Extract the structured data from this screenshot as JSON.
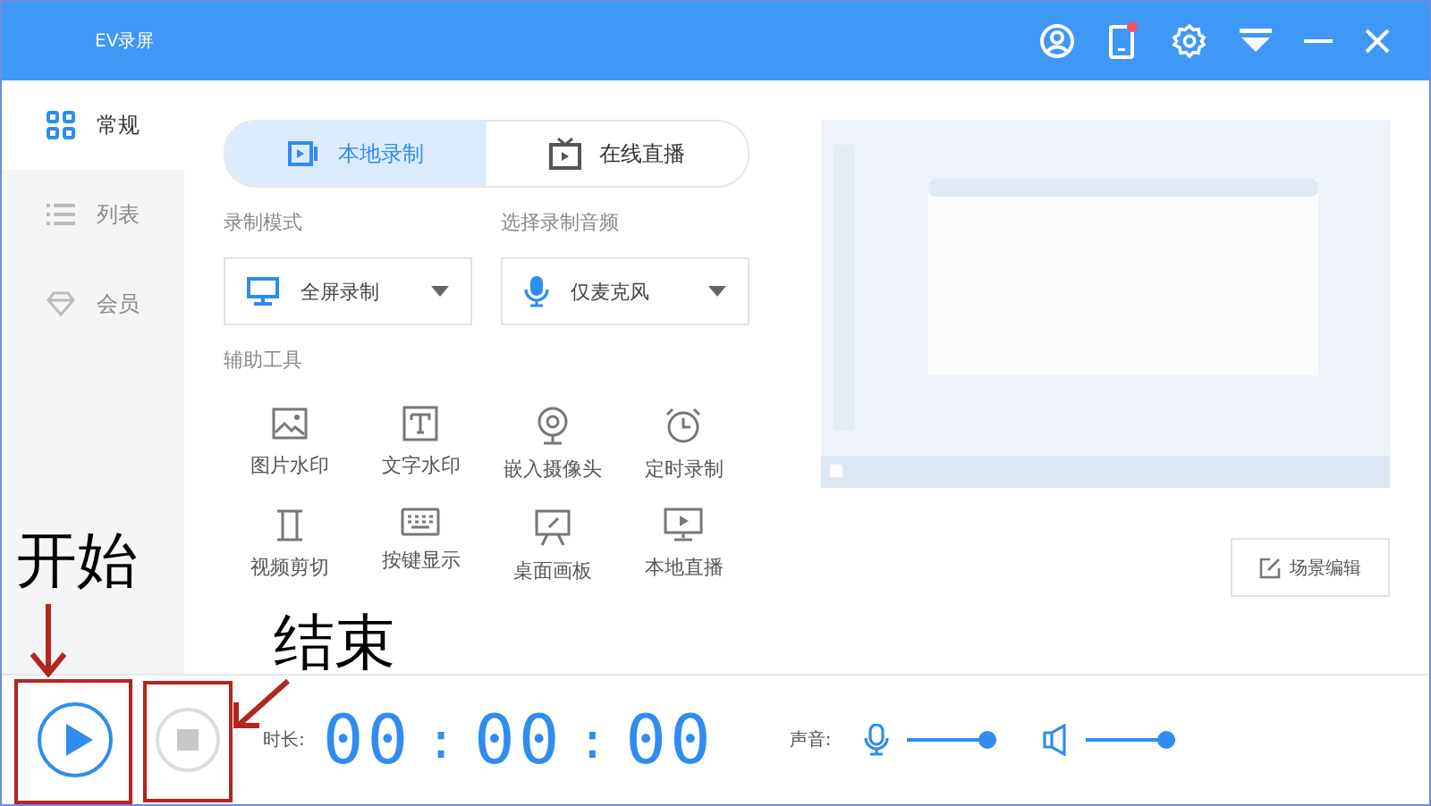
{
  "window": {
    "title": "EV录屏"
  },
  "sidebar": {
    "items": [
      {
        "label": "常规",
        "selected": true,
        "kind": "grid"
      },
      {
        "label": "列表",
        "selected": false,
        "kind": "list"
      },
      {
        "label": "会员",
        "selected": false,
        "kind": "gem"
      }
    ]
  },
  "tabs": [
    {
      "label": "本地录制",
      "selected": true,
      "kind": "record"
    },
    {
      "label": "在线直播",
      "selected": false,
      "kind": "tv"
    }
  ],
  "record_mode": {
    "label": "录制模式",
    "value": "全屏录制"
  },
  "audio": {
    "label": "选择录制音频",
    "value": "仅麦克风"
  },
  "tools": {
    "label": "辅助工具",
    "items": [
      {
        "label": "图片水印",
        "kind": "image"
      },
      {
        "label": "文字水印",
        "kind": "text"
      },
      {
        "label": "嵌入摄像头",
        "kind": "camera"
      },
      {
        "label": "定时录制",
        "kind": "clock"
      },
      {
        "label": "视频剪切",
        "kind": "cut"
      },
      {
        "label": "按键显示",
        "kind": "keyboard"
      },
      {
        "label": "桌面画板",
        "kind": "board"
      },
      {
        "label": "本地直播",
        "kind": "live"
      }
    ]
  },
  "scene_button": "场景编辑",
  "bottom": {
    "duration_label": "时长:",
    "time": [
      "00",
      ":",
      "00",
      ":",
      "00"
    ],
    "sound_label": "声音:",
    "sliders": [
      {
        "kind": "mic",
        "level": 1
      },
      {
        "kind": "speaker",
        "level": 1
      }
    ]
  },
  "annotations": [
    {
      "text": "开始",
      "kind": "start"
    },
    {
      "text": "结束",
      "kind": "stop"
    }
  ]
}
